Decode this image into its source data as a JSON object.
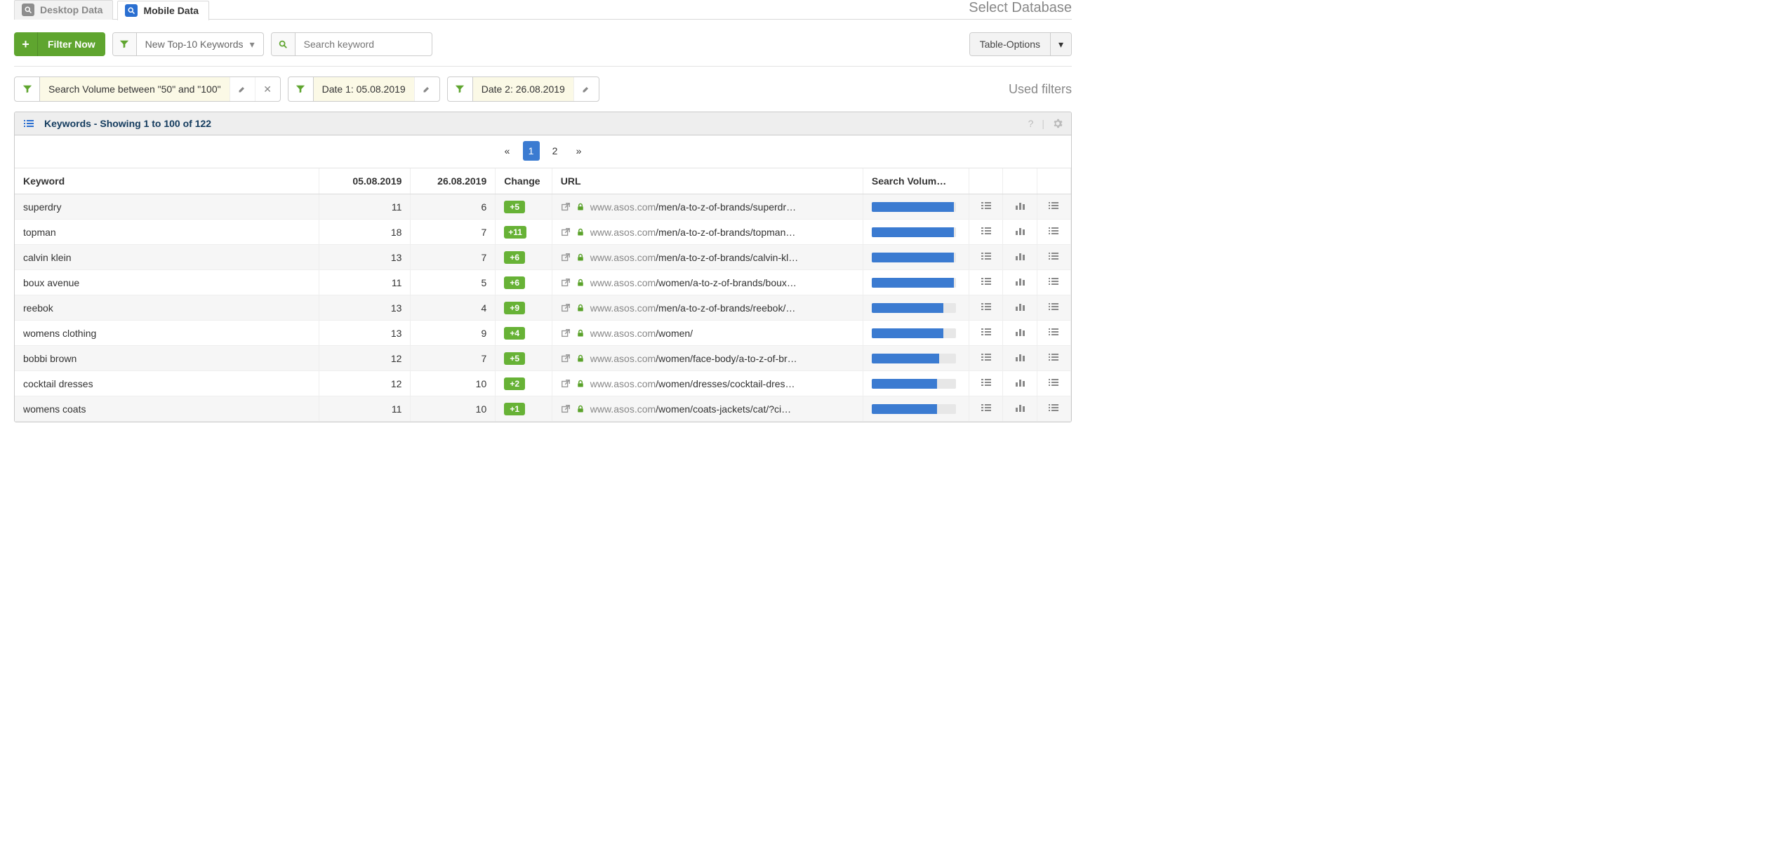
{
  "tabs": {
    "desktop": "Desktop Data",
    "mobile": "Mobile Data"
  },
  "select_database": "Select Database",
  "toolbar": {
    "filter_now": "Filter Now",
    "dropdown_label": "New Top-10 Keywords",
    "search_placeholder": "Search keyword",
    "table_options": "Table-Options"
  },
  "filters": {
    "sv": "Search Volume between \"50\" and \"100\"",
    "date1": "Date 1: 05.08.2019",
    "date2": "Date 2: 26.08.2019",
    "used_filters": "Used filters"
  },
  "panel": {
    "title": "Keywords - Showing 1 to 100 of 122",
    "pages": [
      "1",
      "2"
    ],
    "current_page": "1"
  },
  "columns": {
    "keyword": "Keyword",
    "d1": "05.08.2019",
    "d2": "26.08.2019",
    "change": "Change",
    "url": "URL",
    "sv": "Search Volum…"
  },
  "rows": [
    {
      "kw": "superdry",
      "d1": "11",
      "d2": "6",
      "ch": "+5",
      "dom": "www.asos.com",
      "path": "/men/a-to-z-of-brands/superdr…",
      "sv": 98
    },
    {
      "kw": "topman",
      "d1": "18",
      "d2": "7",
      "ch": "+11",
      "dom": "www.asos.com",
      "path": "/men/a-to-z-of-brands/topman…",
      "sv": 98
    },
    {
      "kw": "calvin klein",
      "d1": "13",
      "d2": "7",
      "ch": "+6",
      "dom": "www.asos.com",
      "path": "/men/a-to-z-of-brands/calvin-kl…",
      "sv": 98
    },
    {
      "kw": "boux avenue",
      "d1": "11",
      "d2": "5",
      "ch": "+6",
      "dom": "www.asos.com",
      "path": "/women/a-to-z-of-brands/boux…",
      "sv": 98
    },
    {
      "kw": "reebok",
      "d1": "13",
      "d2": "4",
      "ch": "+9",
      "dom": "www.asos.com",
      "path": "/men/a-to-z-of-brands/reebok/…",
      "sv": 85
    },
    {
      "kw": "womens clothing",
      "d1": "13",
      "d2": "9",
      "ch": "+4",
      "dom": "www.asos.com",
      "path": "/women/",
      "sv": 85
    },
    {
      "kw": "bobbi brown",
      "d1": "12",
      "d2": "7",
      "ch": "+5",
      "dom": "www.asos.com",
      "path": "/women/face-body/a-to-z-of-br…",
      "sv": 80
    },
    {
      "kw": "cocktail dresses",
      "d1": "12",
      "d2": "10",
      "ch": "+2",
      "dom": "www.asos.com",
      "path": "/women/dresses/cocktail-dres…",
      "sv": 78
    },
    {
      "kw": "womens coats",
      "d1": "11",
      "d2": "10",
      "ch": "+1",
      "dom": "www.asos.com",
      "path": "/women/coats-jackets/cat/?ci…",
      "sv": 78
    }
  ]
}
